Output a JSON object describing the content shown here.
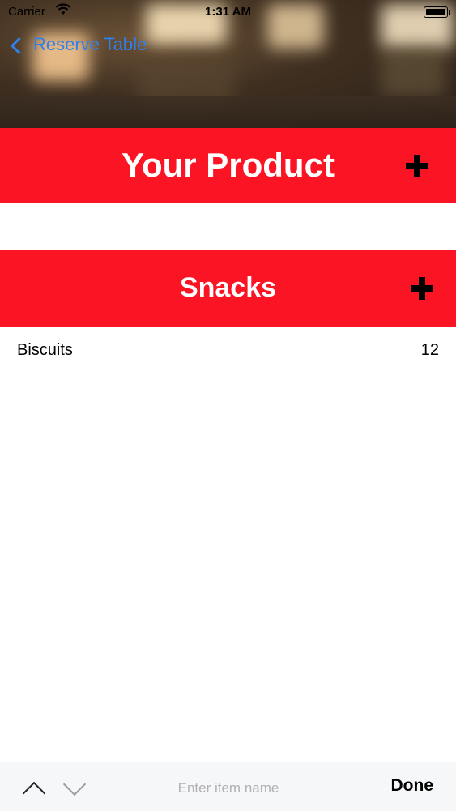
{
  "status_bar": {
    "carrier": "Carrier",
    "time": "1:31 AM"
  },
  "nav": {
    "back_label": "Reserve Table"
  },
  "sections": [
    {
      "title": "Your Product",
      "add_icon": "plus-icon"
    },
    {
      "title": "Snacks",
      "add_icon": "plus-icon"
    }
  ],
  "items": [
    {
      "name": "Biscuits",
      "quantity": "12"
    }
  ],
  "accessory": {
    "placeholder": "Enter item name",
    "done_label": "Done"
  },
  "colors": {
    "section_bar": "#fa1424",
    "link": "#2f80ed",
    "row_separator": "#f08a8a"
  }
}
